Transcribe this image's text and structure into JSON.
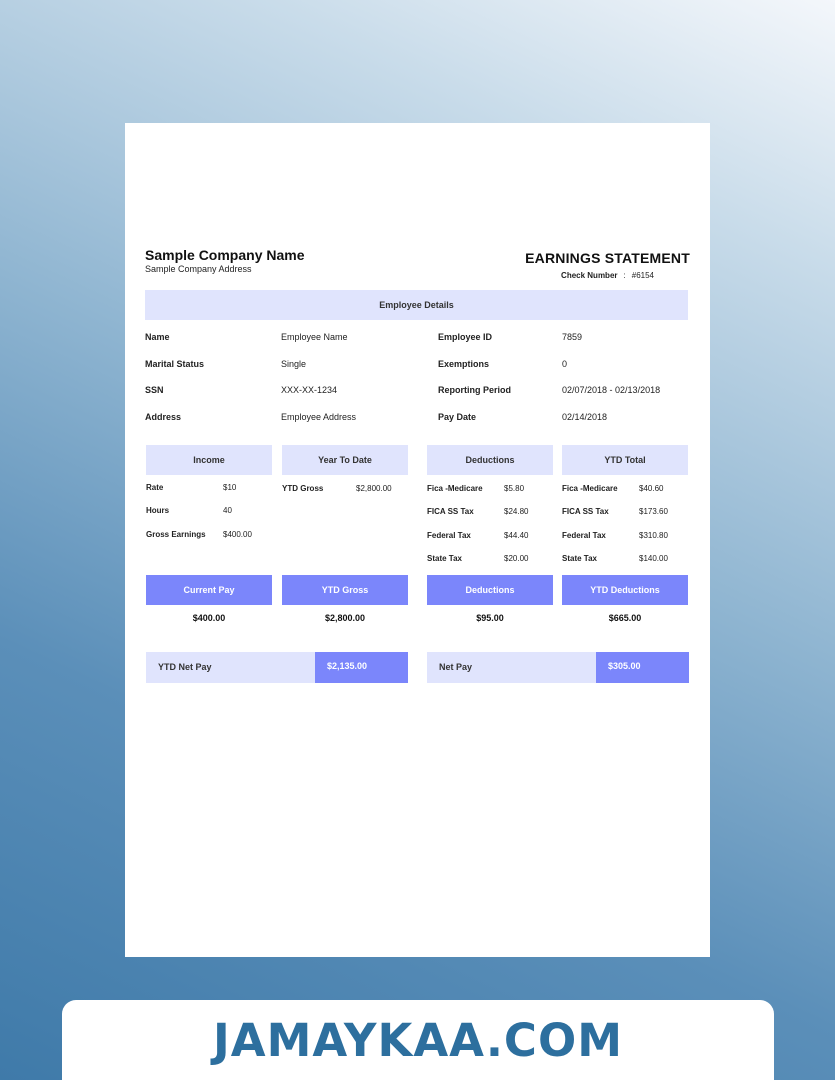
{
  "header": {
    "company_name": "Sample Company Name",
    "company_address": "Sample Company Address",
    "statement_title": "EARNINGS STATEMENT",
    "check_label": "Check Number",
    "check_sep": ":",
    "check_number": "#6154"
  },
  "employee": {
    "section_title": "Employee Details",
    "rows": [
      {
        "l1": "Name",
        "v1": "Employee Name",
        "l2": "Employee ID",
        "v2": "7859"
      },
      {
        "l1": "Marital Status",
        "v1": "Single",
        "l2": "Exemptions",
        "v2": "0"
      },
      {
        "l1": "SSN",
        "v1": "XXX-XX-1234",
        "l2": "Reporting Period",
        "v2": "02/07/2018 - 02/13/2018"
      },
      {
        "l1": "Address",
        "v1": "Employee Address",
        "l2": "Pay Date",
        "v2": "02/14/2018"
      }
    ]
  },
  "columns": {
    "income": "Income",
    "ytd": "Year To Date",
    "deductions": "Deductions",
    "ytd_total": "YTD Total"
  },
  "income": [
    {
      "label": "Rate",
      "value": "$10"
    },
    {
      "label": "Hours",
      "value": "40"
    },
    {
      "label": "Gross Earnings",
      "value": "$400.00"
    }
  ],
  "year_to_date": [
    {
      "label": "YTD Gross",
      "value": "$2,800.00"
    }
  ],
  "deductions": [
    {
      "label": "Fica -Medicare",
      "value": "$5.80"
    },
    {
      "label": "FICA SS Tax",
      "value": "$24.80"
    },
    {
      "label": "Federal Tax",
      "value": "$44.40"
    },
    {
      "label": "State Tax",
      "value": "$20.00"
    }
  ],
  "ytd_total": [
    {
      "label": "Fica -Medicare",
      "value": "$40.60"
    },
    {
      "label": "FICA SS Tax",
      "value": "$173.60"
    },
    {
      "label": "Federal Tax",
      "value": "$310.80"
    },
    {
      "label": "State Tax",
      "value": "$140.00"
    }
  ],
  "summary": [
    {
      "label": "Current Pay",
      "value": "$400.00"
    },
    {
      "label": "YTD Gross",
      "value": "$2,800.00"
    },
    {
      "label": "Deductions",
      "value": "$95.00"
    },
    {
      "label": "YTD Deductions",
      "value": "$665.00"
    }
  ],
  "net": {
    "ytd_label": "YTD Net Pay",
    "ytd_value": "$2,135.00",
    "net_label": "Net Pay",
    "net_value": "$305.00"
  },
  "footer": {
    "brand": "JAMAYKAA.COM"
  },
  "colors": {
    "band_light": "#e0e4fd",
    "band_strong": "#7b86fb",
    "footer_text": "#2d6f9e"
  }
}
